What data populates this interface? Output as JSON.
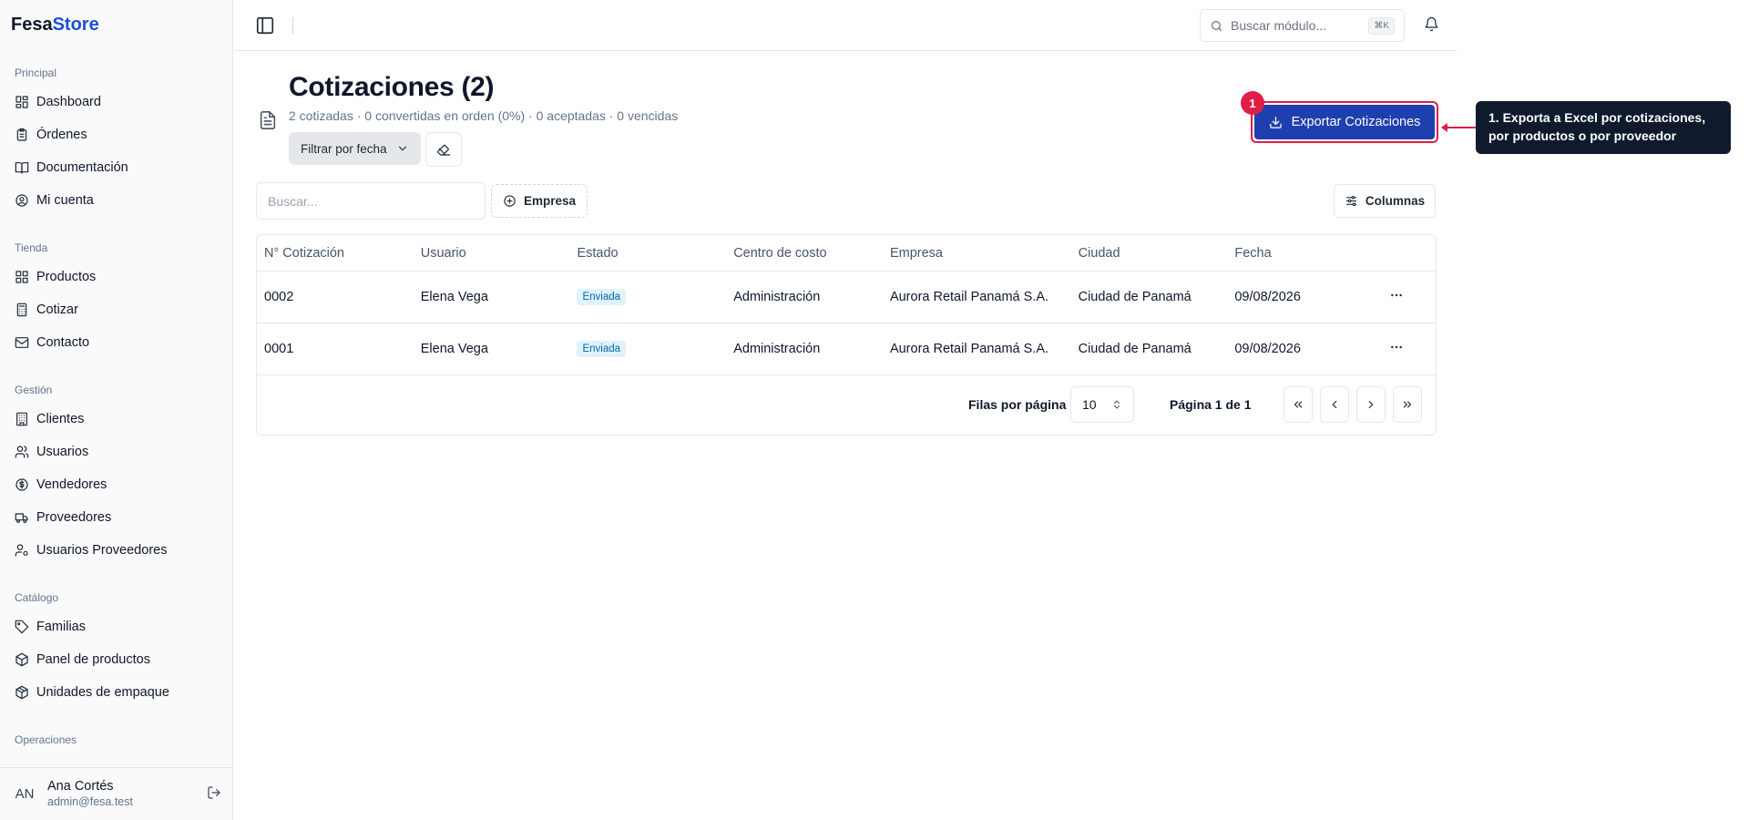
{
  "brand": {
    "part1": "Fesa",
    "part2": "Store"
  },
  "sidebar": {
    "groups": [
      {
        "label": "Principal",
        "items": [
          {
            "label": "Dashboard",
            "icon": "dashboard-icon"
          },
          {
            "label": "Órdenes",
            "icon": "clipboard-icon"
          },
          {
            "label": "Documentación",
            "icon": "book-icon"
          },
          {
            "label": "Mi cuenta",
            "icon": "user-circle-icon"
          }
        ]
      },
      {
        "label": "Tienda",
        "items": [
          {
            "label": "Productos",
            "icon": "grid-icon"
          },
          {
            "label": "Cotizar",
            "icon": "calculator-icon"
          },
          {
            "label": "Contacto",
            "icon": "mail-icon"
          }
        ]
      },
      {
        "label": "Gestión",
        "items": [
          {
            "label": "Clientes",
            "icon": "building-icon"
          },
          {
            "label": "Usuarios",
            "icon": "users-icon"
          },
          {
            "label": "Vendedores",
            "icon": "dollar-circle-icon"
          },
          {
            "label": "Proveedores",
            "icon": "truck-icon"
          },
          {
            "label": "Usuarios Proveedores",
            "icon": "user-cog-icon"
          }
        ]
      },
      {
        "label": "Catálogo",
        "items": [
          {
            "label": "Familias",
            "icon": "tag-icon"
          },
          {
            "label": "Panel de productos",
            "icon": "package-icon"
          },
          {
            "label": "Unidades de empaque",
            "icon": "box-icon"
          }
        ]
      },
      {
        "label": "Operaciones",
        "items": []
      }
    ]
  },
  "user": {
    "initials": "AN",
    "name": "Ana Cortés",
    "email": "admin@fesa.test"
  },
  "topbar": {
    "search_placeholder": "Buscar módulo...",
    "shortcut": "⌘K"
  },
  "page": {
    "title": "Cotizaciones (2)",
    "subtitle": "2 cotizadas · 0 convertidas en orden (0%) · 0 aceptadas · 0 vencidas",
    "filter_label": "Filtrar por fecha",
    "export_label": "Exportar Cotizaciones",
    "search_placeholder": "Buscar...",
    "empresa_label": "Empresa",
    "columns_label": "Columnas"
  },
  "table": {
    "headers": [
      "N° Cotización",
      "Usuario",
      "Estado",
      "Centro de costo",
      "Empresa",
      "Ciudad",
      "Fecha"
    ],
    "rows": [
      {
        "num": "0002",
        "usuario": "Elena Vega",
        "estado": "Enviada",
        "centro": "Administración",
        "empresa": "Aurora Retail Panamá S.A.",
        "ciudad": "Ciudad de Panamá",
        "fecha": "09/08/2026"
      },
      {
        "num": "0001",
        "usuario": "Elena Vega",
        "estado": "Enviada",
        "centro": "Administración",
        "empresa": "Aurora Retail Panamá S.A.",
        "ciudad": "Ciudad de Panamá",
        "fecha": "09/08/2026"
      }
    ]
  },
  "pagination": {
    "rows_label": "Filas por página",
    "rows_value": "10",
    "page_info": "Página 1 de 1"
  },
  "tour": {
    "step": "1",
    "text": "1. Exporta a Excel por cotizaciones, por productos o por proveedor"
  },
  "colors": {
    "accent": "#1e40af",
    "highlight": "#e11d48",
    "tooltip_bg": "#0f1b2d"
  }
}
